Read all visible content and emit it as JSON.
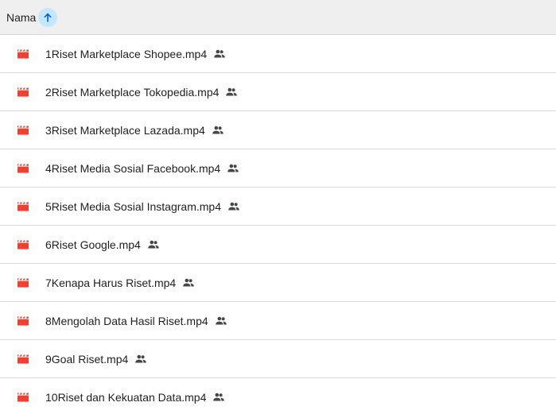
{
  "header": {
    "column_label": "Nama",
    "sort_icon": "arrow-up-icon",
    "sort_accent": "#c2e7ff",
    "sort_arrow_color": "#0b57d0"
  },
  "icons": {
    "file": "video-file-icon",
    "file_color": "#ea4335",
    "shared": "shared-people-icon",
    "shared_color": "#444746"
  },
  "files": [
    {
      "name": "1Riset Marketplace Shopee.mp4"
    },
    {
      "name": "2Riset Marketplace Tokopedia.mp4"
    },
    {
      "name": "3Riset Marketplace Lazada.mp4"
    },
    {
      "name": "4Riset Media Sosial Facebook.mp4"
    },
    {
      "name": "5Riset Media Sosial Instagram.mp4"
    },
    {
      "name": "6Riset Google.mp4"
    },
    {
      "name": "7Kenapa Harus Riset.mp4"
    },
    {
      "name": "8Mengolah Data Hasil Riset.mp4"
    },
    {
      "name": "9Goal Riset.mp4"
    },
    {
      "name": "10Riset dan Kekuatan Data.mp4"
    }
  ]
}
